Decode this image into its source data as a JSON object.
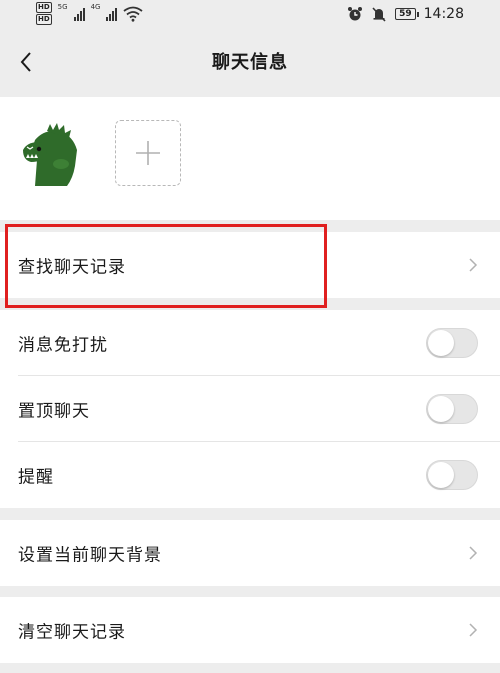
{
  "status_bar": {
    "hd_badges": [
      "HD",
      "HD"
    ],
    "network_labels": [
      "5G",
      "4G"
    ],
    "battery": "59",
    "time": "14:28"
  },
  "nav": {
    "title": "聊天信息",
    "back_icon": "chevron-left-icon"
  },
  "members": {
    "avatar_icon": "dinosaur-avatar",
    "add_icon": "plus-icon"
  },
  "cells": {
    "search_history": "查找聊天记录",
    "do_not_disturb": "消息免打扰",
    "pin_chat": "置顶聊天",
    "remind": "提醒",
    "set_background": "设置当前聊天背景",
    "clear_history": "清空聊天记录"
  },
  "toggles": {
    "do_not_disturb": false,
    "pin_chat": false,
    "remind": false
  },
  "colors": {
    "highlight": "#e02020",
    "background": "#ededed",
    "avatar_green": "#2f6b2a"
  }
}
